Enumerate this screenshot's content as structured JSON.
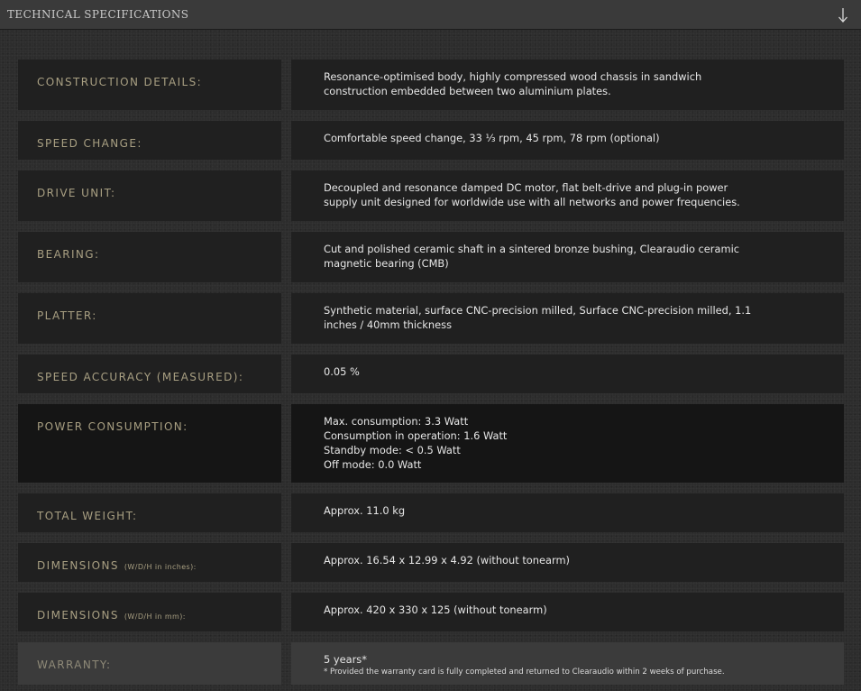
{
  "header": {
    "title": "TECHNICAL SPECIFICATIONS",
    "toggle_icon": "arrow-down-icon",
    "toggle_glyph": "↓"
  },
  "colors": {
    "label_gold": "#a89f82",
    "cell_bg": "#202020",
    "value_text": "#e6e6e6"
  },
  "specs": [
    {
      "label": "CONSTRUCTION DETAILS:",
      "value": [
        "Resonance-optimised body, highly compressed wood chassis in sandwich",
        "construction embedded between two aluminium plates."
      ]
    },
    {
      "label": "SPEED CHANGE:",
      "value": [
        "Comfortable speed change, 33 ⅓ rpm, 45 rpm, 78 rpm (optional)"
      ]
    },
    {
      "label": "DRIVE UNIT:",
      "value": [
        "Decoupled and resonance damped DC motor, flat belt-drive and plug-in power",
        "supply unit designed for worldwide use with all networks and power frequencies."
      ]
    },
    {
      "label": "BEARING:",
      "value": [
        "Cut and polished ceramic shaft in a sintered bronze bushing, Clearaudio ceramic",
        "magnetic bearing (CMB)"
      ]
    },
    {
      "label": "PLATTER:",
      "value": [
        "Synthetic material, surface CNC-precision milled, Surface CNC-precision milled, 1.1",
        "inches / 40mm thickness"
      ]
    },
    {
      "label": "SPEED ACCURACY (MEASURED):",
      "value": [
        "0.05 %"
      ]
    },
    {
      "label": "POWER CONSUMPTION:",
      "value": [
        "Max. consumption: 3.3 Watt",
        "Consumption in operation: 1.6 Watt",
        "Standby mode: < 0.5 Watt",
        "Off mode: 0.0 Watt"
      ]
    },
    {
      "label": "TOTAL WEIGHT:",
      "value": [
        "Approx. 11.0 kg"
      ]
    },
    {
      "label": "DIMENSIONS",
      "unit": "(W/D/H in inches):",
      "value": [
        "Approx. 16.54 x 12.99 x 4.92 (without tonearm)"
      ]
    },
    {
      "label": "DIMENSIONS",
      "unit": "(W/D/H in mm):",
      "value": [
        "Approx. 420 x 330 x 125 (without tonearm)"
      ]
    },
    {
      "label": "WARRANTY:",
      "value": [
        "5 years*"
      ],
      "note": "* Provided the warranty card is fully completed and returned to Clearaudio within 2 weeks of purchase."
    }
  ]
}
